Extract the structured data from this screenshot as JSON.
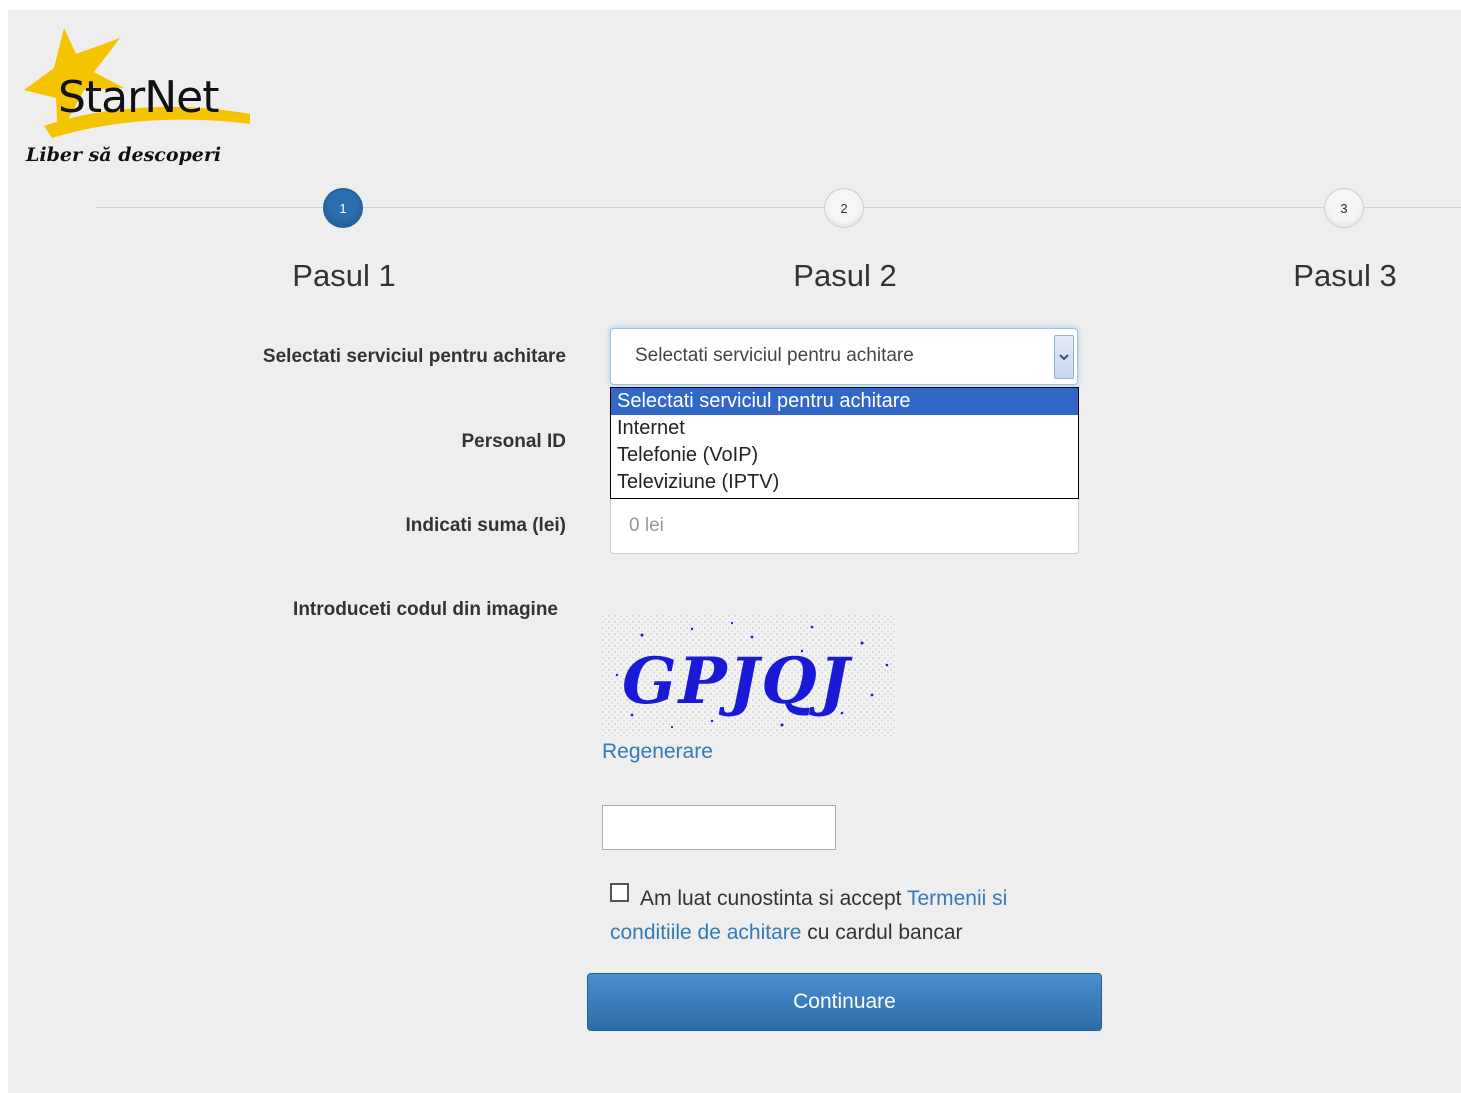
{
  "brand": {
    "name": "StarNet",
    "tagline": "Liber să descoperi"
  },
  "steps": [
    {
      "number": "1",
      "label": "Pasul 1",
      "active": true
    },
    {
      "number": "2",
      "label": "Pasul 2",
      "active": false
    },
    {
      "number": "3",
      "label": "Pasul 3",
      "active": false
    }
  ],
  "form": {
    "service_label": "Selectati serviciul pentru achitare",
    "service_value": "Selectati serviciul pentru achitare",
    "service_options": [
      "Selectati serviciul pentru achitare",
      "Internet",
      "Telefonie (VoIP)",
      "Televiziune (IPTV)"
    ],
    "personal_id_label": "Personal ID",
    "amount_label": "Indicati suma (lei)",
    "amount_placeholder": "0 lei",
    "captcha_label": "Introduceti codul din imagine",
    "captcha_text": "GPJQJ",
    "regenerate_link": "Regenerare",
    "terms_prefix": "Am luat cunostinta si accept",
    "terms_link": "Termenii si conditiile de achitare",
    "terms_suffix": "cu cardul bancar",
    "continue_button": "Continuare"
  },
  "colors": {
    "accent": "#337ab7",
    "primary_button": "#2e6ca8",
    "active_step": "#2c6fb0",
    "selected_option": "#3168c7",
    "logo_yellow": "#f5c400",
    "captcha_blue": "#1a1ad6"
  },
  "icons": {
    "dropdown": "chevron-down-icon",
    "logo_star": "star-icon"
  }
}
